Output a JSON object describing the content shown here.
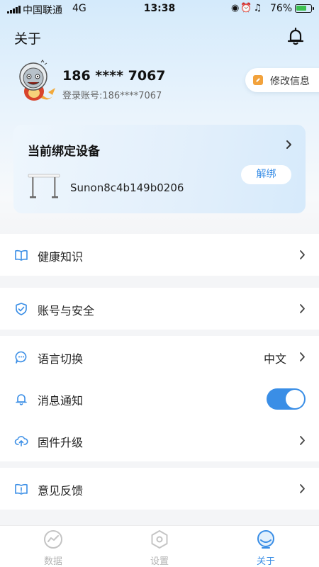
{
  "status_bar": {
    "carrier": "中国联通",
    "network": "4G",
    "time": "13:38",
    "battery": "76%",
    "battery_level": 0.76
  },
  "header": {
    "title": "关于",
    "bell_icon": "bell-icon"
  },
  "profile": {
    "phone": "186 **** 7067",
    "account": "登录账号:186****7067",
    "edit_label": "修改信息"
  },
  "device": {
    "title": "当前绑定设备",
    "name": "Sunon8c4b149b0206",
    "unbind_label": "解绑"
  },
  "menu": {
    "health": {
      "label": "健康知识",
      "icon": "book-icon"
    },
    "security": {
      "label": "账号与安全",
      "icon": "shield-icon"
    },
    "language": {
      "label": "语言切换",
      "value": "中文",
      "icon": "chat-bubble-icon"
    },
    "notification": {
      "label": "消息通知",
      "icon": "bell-icon",
      "enabled": true
    },
    "firmware": {
      "label": "固件升级",
      "icon": "cloud-upload-icon"
    },
    "feedback": {
      "label": "意见反馈",
      "icon": "feedback-book-icon"
    }
  },
  "tabs": [
    {
      "label": "数据",
      "icon": "chart-icon",
      "active": false
    },
    {
      "label": "设置",
      "icon": "hexagon-settings-icon",
      "active": false
    },
    {
      "label": "关于",
      "icon": "about-icon",
      "active": true
    }
  ],
  "colors": {
    "accent": "#3a8ee6",
    "edit_icon": "#f2a23c",
    "battery": "#3cc051"
  }
}
